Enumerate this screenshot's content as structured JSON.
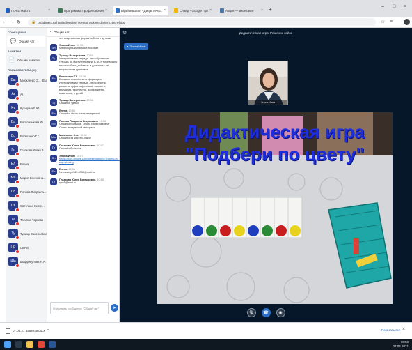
{
  "browser": {
    "tabs": [
      {
        "label": "Почта Mail.ru",
        "color": "#1f5fbf",
        "active": false
      },
      {
        "label": "Программы Профессиональн...",
        "color": "#3b7a57",
        "active": false
      },
      {
        "label": "BigBlueButton - Дидактичес...",
        "color": "#2d6fc4",
        "active": true
      },
      {
        "label": "Слайд - Google Презентации",
        "color": "#f4b400",
        "active": false
      },
      {
        "label": "Акция — Вконтакте",
        "color": "#4a76a8",
        "active": false
      }
    ],
    "url": "p.cabinets.ru/html5client/join?sessionToken=dzdmrk1687efxjgg",
    "lock_icon": "lock-icon"
  },
  "sidebar": {
    "messages_heading": "СООБЩЕНИЯ",
    "public_chat_label": "Общий чат",
    "notes_heading": "ЗАМЕТКИ",
    "shared_notes_label": "Общие заметки",
    "users_heading": "ПОЛЬЗОВАТЕЛИ (33)",
    "users": [
      {
        "initials": "Вы",
        "name": "Мыскленко Э... (Вы)"
      },
      {
        "initials": "Ar",
        "name": "Ar"
      },
      {
        "initials": "Ку",
        "name": "Кутьдина Е.Ю."
      },
      {
        "initials": "Ба",
        "name": "Баталионкова Ю..."
      },
      {
        "initials": "Бо",
        "name": "Борисенко Г.Г."
      },
      {
        "initials": "Гл",
        "name": "Глазкова Юлия В..."
      },
      {
        "initials": "Ел",
        "name": "Елена"
      },
      {
        "initials": "Ма",
        "name": "Мария Еленовна..."
      },
      {
        "initials": "По",
        "name": "Попова Людмила..."
      },
      {
        "initials": "Св",
        "name": "Светлана Серге..."
      },
      {
        "initials": "Та",
        "name": "Татьяна Чернова"
      },
      {
        "initials": "Ту",
        "name": "Тулица Валерьевна"
      },
      {
        "initials": "ЦЕ",
        "name": "ЦЕПО"
      },
      {
        "initials": "Ша",
        "name": "Шафрикулова Н.А."
      }
    ]
  },
  "chat": {
    "header": "Общий чат",
    "messages": [
      {
        "initials": "",
        "name": "",
        "time": "",
        "text": "это современная форма работы с детьми"
      },
      {
        "initials": "Эл",
        "name": "Элона Ином",
        "time": "10:55",
        "text": "Многофункциональное пособие"
      },
      {
        "initials": "Ту",
        "name": "Тулица Валерьевна",
        "time": "10:55",
        "text": "Интерактивная тетрадь - это обучающая тетрадь на смену тетрадей, В ДОУ тоже можно приспособить, добавить и дополнить ее возрастными уровнями"
      },
      {
        "initials": "Бо",
        "name": "Борисенко Г.Г.",
        "time": "10:56",
        "text": "Большое спасибо за информацию. Интерактивная тетрадь - это средство развития орфографической зоркости, внимания, творчества, воображения, мышления, у детей"
      },
      {
        "initials": "Ту",
        "name": "Тулица Валерьевна",
        "time": "10:56",
        "text": "Спасибо, удачи!"
      },
      {
        "initials": "Ел",
        "name": "Елена",
        "time": "10:56",
        "text": "Спасибо, было очень интересно!"
      },
      {
        "initials": "По",
        "name": "Попова Людмила Георгиевна",
        "time": "10:56",
        "text": "Спасибо большое, Элона Вячеславовна. Очень интересный материал"
      },
      {
        "initials": "Мы",
        "name": "Мысленко Э.А.",
        "time": "10:56",
        "text": "Спасибо за мастер-класс!"
      },
      {
        "initials": "Гл",
        "name": "Глазкова Юлия Викторовна",
        "time": "10:57",
        "text": "Спасибо большое"
      },
      {
        "initials": "Эл",
        "name": "Элона Ином",
        "time": "10:57",
        "text": "https://docs.google.com/presentation/d/1pRH9DIN_Tbx6N...8378LjcEtnh9MPcFdens.ru/edit?usp=sharing",
        "link": true
      },
      {
        "initials": "Ел",
        "name": "Елена",
        "time": "10:58",
        "text": "Nekrasovy1960-8956@mail.ru"
      },
      {
        "initials": "Гл",
        "name": "Глазкова Юлия Викторовна",
        "time": "10:58",
        "text": "rgnr1@mail.ru"
      }
    ],
    "input_placeholder": "Отправить сообщение \"Общий чат\"",
    "send_icon": "send-icon"
  },
  "stage": {
    "title": "Дидактическая игра. Решение кейса",
    "presenter_label": "Элона Ином",
    "webcam_name": "Элона Ином",
    "slide_title": "Дидактическая игра \"Подбери по цвету\"",
    "circles": [
      "#1f3fbf",
      "#2a8a36",
      "#c81e1e",
      "#e8d21e",
      "#1f3fbf",
      "#2a8a36",
      "#c81e1e",
      "#e8d21e"
    ],
    "controls": [
      "microphone-icon",
      "phone-icon",
      "camera-icon"
    ]
  },
  "downloads": {
    "file_label": "07.04.21 Заметки.docx",
    "show_all": "Показать все"
  },
  "taskbar": {
    "time": "10:58",
    "date": "07.04.2021"
  },
  "colors": {
    "accent": "#2d6fc4",
    "stage_bg": "#06172a",
    "avatar": "#2a3c8c",
    "mic_off": "#e5322f",
    "slide_title": "#1e2edb"
  }
}
